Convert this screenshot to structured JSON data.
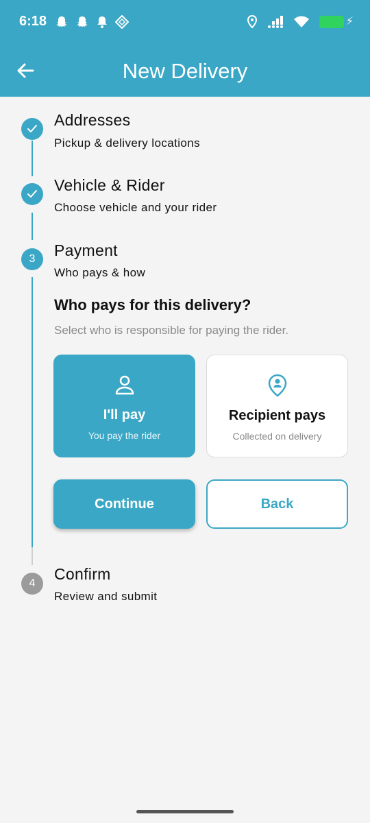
{
  "status_bar": {
    "time": "6:18",
    "icons": [
      "snapchat-icon",
      "snapchat-icon",
      "notification-bell-icon",
      "app-diamond-icon",
      "location-icon",
      "signal-icon",
      "wifi-icon",
      "battery-charging-icon"
    ],
    "battery_color": "#2fd35d"
  },
  "app_bar": {
    "title": "New Delivery",
    "back_icon": "arrow-back-icon",
    "color": "#3ba7c6"
  },
  "steps": [
    {
      "title": "Addresses",
      "subtitle": "Pickup & delivery locations",
      "state": "completed",
      "marker": "check-icon"
    },
    {
      "title": "Vehicle & Rider",
      "subtitle": "Choose vehicle and your rider",
      "state": "completed",
      "marker": "check-icon"
    },
    {
      "title": "Payment",
      "subtitle": "Who pays & how",
      "state": "active",
      "number": "3"
    },
    {
      "title": "Confirm",
      "subtitle": "Review and submit",
      "state": "inactive",
      "number": "4"
    }
  ],
  "payment": {
    "question": "Who pays for this delivery?",
    "hint": "Select who is responsible for paying the rider.",
    "options": [
      {
        "title": "I'll pay",
        "subtitle": "You pay the rider",
        "icon": "person-icon",
        "selected": true
      },
      {
        "title": "Recipient pays",
        "subtitle": "Collected on delivery",
        "icon": "location-person-icon",
        "selected": false
      }
    ],
    "continue_label": "Continue",
    "back_label": "Back"
  }
}
